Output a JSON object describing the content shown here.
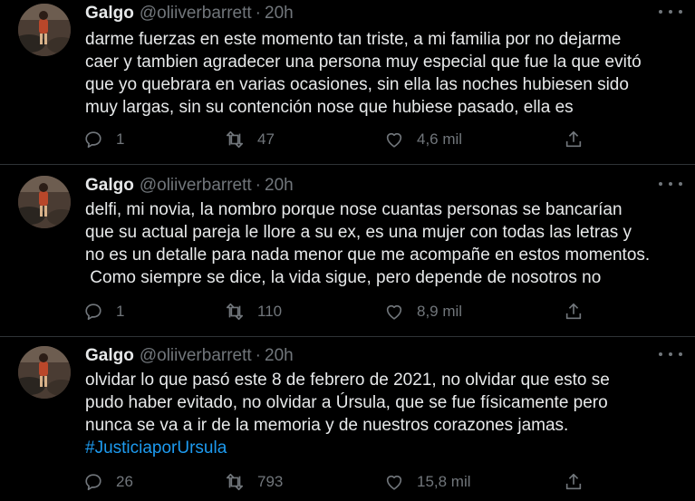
{
  "tweets": [
    {
      "name": "Galgo",
      "handle": "@oliiverbarrett",
      "separator": "·",
      "time": "20h",
      "lines": [
        "darme fuerzas en este momento tan triste, a mi familia por no dejarme",
        "caer y tambien agradecer una persona muy especial que fue la que evitó",
        "que yo quebrara en varias ocasiones, sin ella las noches hubiesen sido",
        "muy largas, sin su contención nose que hubiese pasado, ella es"
      ],
      "hashtag": "",
      "replies": "1",
      "retweets": "47",
      "likes": "4,6 mil"
    },
    {
      "name": "Galgo",
      "handle": "@oliiverbarrett",
      "separator": "·",
      "time": "20h",
      "lines": [
        "delfi, mi novia, la nombro porque nose cuantas personas se bancarían",
        "que su actual pareja le llore a su ex, es una mujer con todas las letras y",
        "no es un detalle para nada menor que me acompañe en estos momentos.",
        " Como siempre se dice, la vida sigue, pero depende de nosotros no"
      ],
      "hashtag": "",
      "replies": "1",
      "retweets": "110",
      "likes": "8,9 mil"
    },
    {
      "name": "Galgo",
      "handle": "@oliiverbarrett",
      "separator": "·",
      "time": "20h",
      "lines": [
        "olvidar lo que pasó este 8 de febrero de 2021, no olvidar que esto se",
        "pudo haber evitado, no olvidar a Úrsula, que se fue físicamente pero",
        "nunca se va a ir de la memoria y de nuestros corazones jamas."
      ],
      "hashtag": "#JusticiaporUrsula",
      "replies": "26",
      "retweets": "793",
      "likes": "15,8 mil"
    }
  ],
  "icons": {
    "reply": "reply-icon",
    "retweet": "retweet-icon",
    "like": "heart-icon",
    "share": "share-icon",
    "more": "more-icon"
  },
  "colors": {
    "background": "#000000",
    "text": "#e7e9ea",
    "secondary": "#71767b",
    "link": "#1d9bf0",
    "divider": "#2f3336"
  }
}
